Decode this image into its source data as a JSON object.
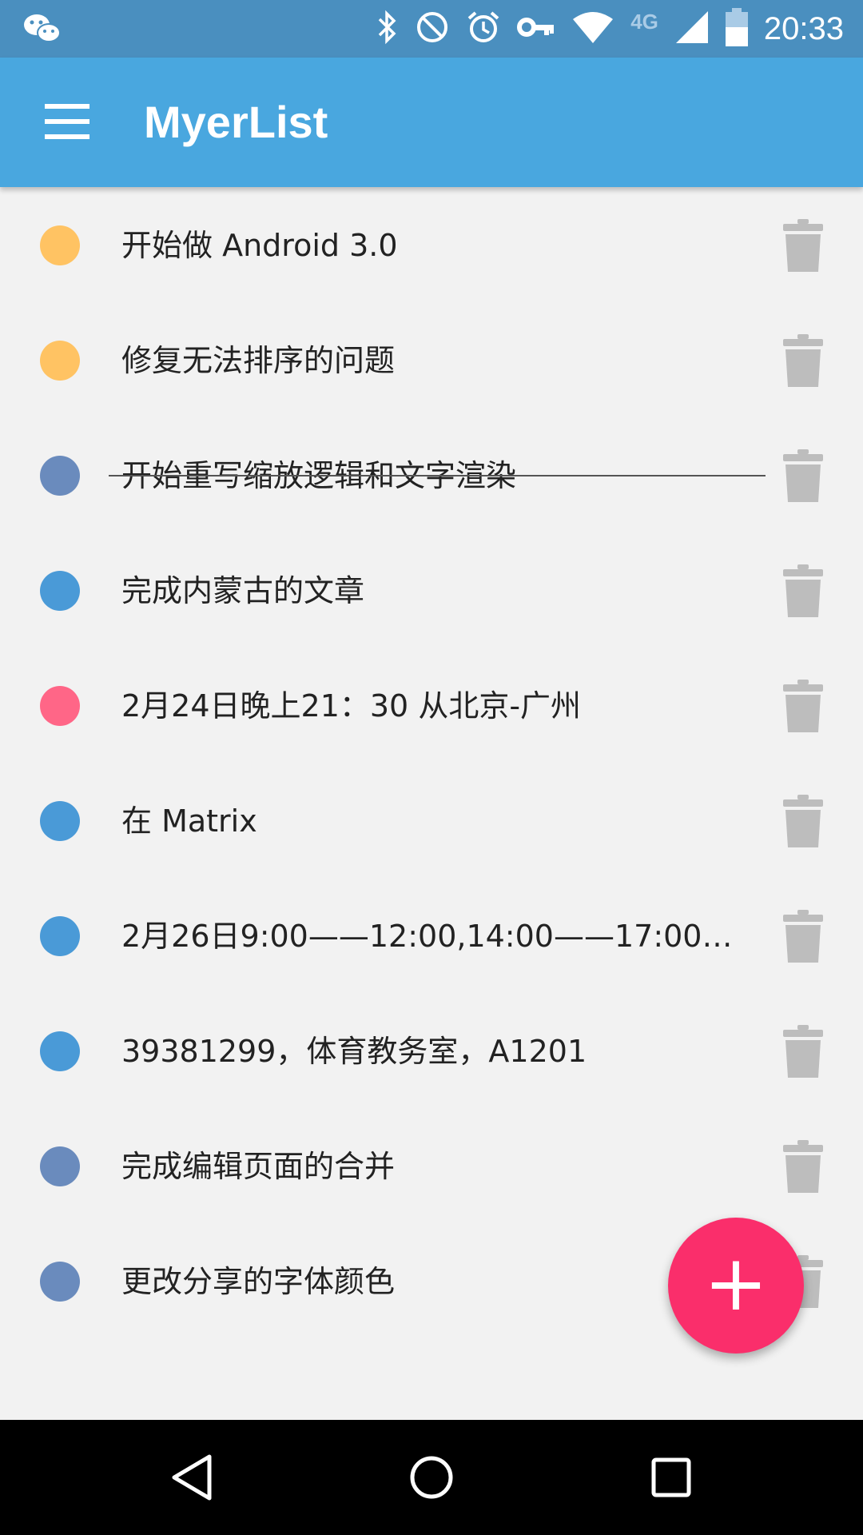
{
  "status_bar": {
    "time": "20:33",
    "network": "4G",
    "icons": [
      "wechat-icon",
      "bluetooth-icon",
      "do-not-disturb-icon",
      "alarm-icon",
      "vpn-key-icon",
      "wifi-icon",
      "signal-icon",
      "battery-icon"
    ]
  },
  "app_bar": {
    "title": "MyerList",
    "menu_icon": "hamburger-menu-icon"
  },
  "tasks": [
    {
      "text": "开始做 Android 3.0",
      "color": "#ffc363",
      "done": false
    },
    {
      "text": "修复无法排序的问题",
      "color": "#ffc363",
      "done": false
    },
    {
      "text": "开始重写缩放逻辑和文字渲染",
      "color": "#6a8bbd",
      "done": true
    },
    {
      "text": "完成内蒙古的文章",
      "color": "#4a9ad7",
      "done": false
    },
    {
      "text": "2月24日晚上21：30 从北京-广州",
      "color": "#ff6687",
      "done": false
    },
    {
      "text": "在 Matrix",
      "color": "#4a9ad7",
      "done": false
    },
    {
      "text": "2月26日9:00——12:00,14:00——17:00；...",
      "color": "#4a9ad7",
      "done": false
    },
    {
      "text": "39381299，体育教务室，A1201",
      "color": "#4a9ad7",
      "done": false
    },
    {
      "text": "完成编辑页面的合并",
      "color": "#6a8bbd",
      "done": false
    },
    {
      "text": "更改分享的字体颜色",
      "color": "#6a8bbd",
      "done": false
    }
  ],
  "fab": {
    "label": "+",
    "color": "#fa2e6b"
  },
  "nav_bar": {
    "buttons": [
      "back-icon",
      "home-icon",
      "recents-icon"
    ]
  }
}
